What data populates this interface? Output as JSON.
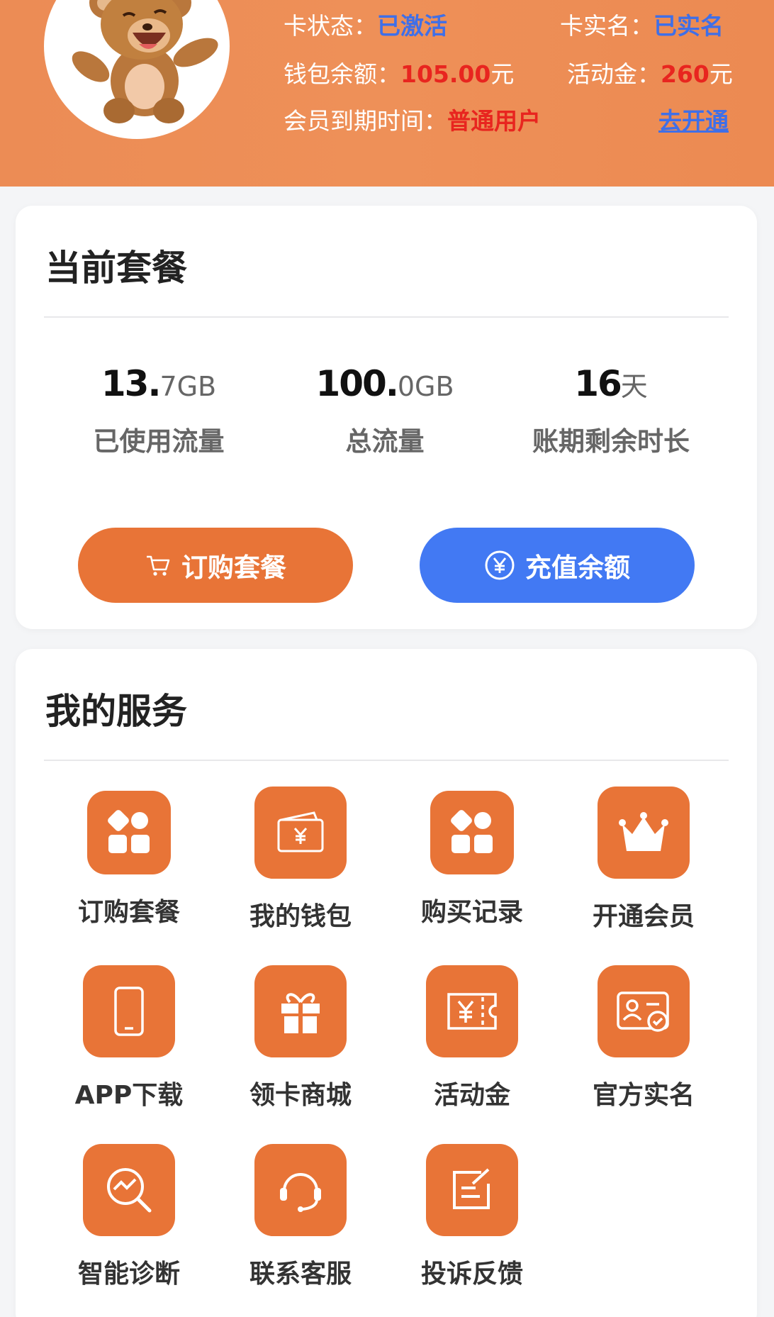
{
  "header": {
    "card_status_label": "卡状态：",
    "card_status_value": "已激活",
    "realname_label": "卡实名：",
    "realname_value": "已实名",
    "wallet_label": "钱包余额：",
    "wallet_value": "105.00",
    "wallet_unit": "元",
    "activity_label": "活动金：",
    "activity_value": "260",
    "activity_unit": "元",
    "member_label": "会员到期时间：",
    "member_value": "普通用户",
    "open_link": "去开通"
  },
  "plan": {
    "title": "当前套餐",
    "stats": [
      {
        "value": "13.",
        "unit": "7GB",
        "label": "已使用流量"
      },
      {
        "value": "100.",
        "unit": "0GB",
        "label": "总流量"
      },
      {
        "value": "16",
        "unit": "天",
        "label": "账期剩余时长"
      }
    ],
    "buy_button": "订购套餐",
    "recharge_button": "充值余额"
  },
  "services": {
    "title": "我的服务",
    "items": [
      {
        "label": "订购套餐",
        "icon": "grid-icon"
      },
      {
        "label": "我的钱包",
        "icon": "wallet-icon"
      },
      {
        "label": "购买记录",
        "icon": "grid-icon"
      },
      {
        "label": "开通会员",
        "icon": "crown-icon"
      },
      {
        "label": "APP下载",
        "icon": "phone-icon"
      },
      {
        "label": "领卡商城",
        "icon": "gift-icon"
      },
      {
        "label": "活动金",
        "icon": "ticket-icon"
      },
      {
        "label": "官方实名",
        "icon": "id-card-icon"
      },
      {
        "label": "智能诊断",
        "icon": "diagnosis-icon"
      },
      {
        "label": "联系客服",
        "icon": "headset-icon"
      },
      {
        "label": "投诉反馈",
        "icon": "feedback-icon"
      }
    ]
  },
  "colors": {
    "header_bg": "#ee8f57",
    "accent_orange": "#e87437",
    "accent_blue": "#4279f3",
    "highlight_red": "#e8251f",
    "link_blue": "#3f6fe8"
  }
}
